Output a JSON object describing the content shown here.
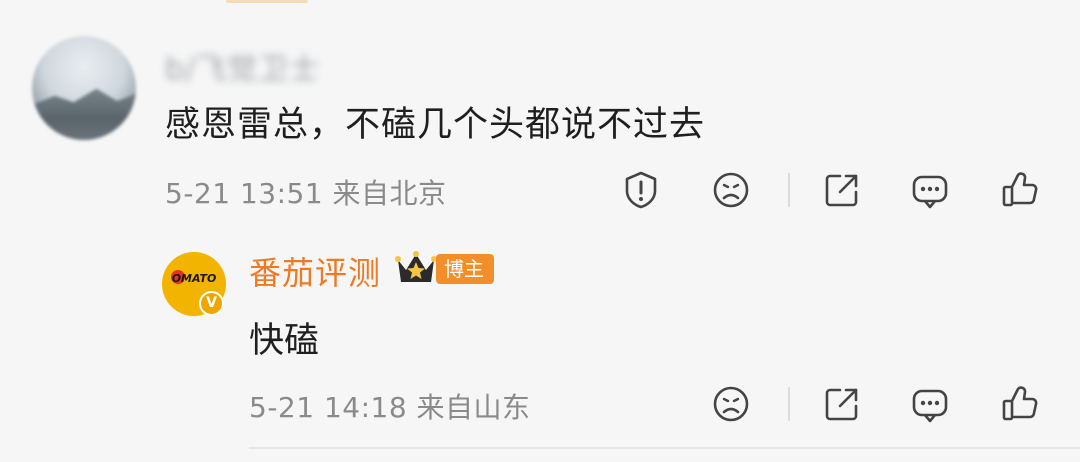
{
  "comment": {
    "username": "b/飞觉卫士",
    "text": "感恩雷总，不磕几个头都说不过去",
    "time": "5-21 13:51",
    "location": "来自北京",
    "actions": [
      "report-icon",
      "emoji-icon",
      "share-icon",
      "comment-icon",
      "like-icon"
    ]
  },
  "reply": {
    "avatar_text": "OMATO",
    "verified_mark": "V",
    "username": "番茄评测",
    "badge": "博主",
    "text": "快磕",
    "time": "5-21 14:18",
    "location": "来自山东",
    "actions": [
      "emoji-icon",
      "share-icon",
      "comment-icon",
      "like-icon"
    ]
  },
  "colors": {
    "background": "#f6f6f6",
    "accent_orange": "#ee7b24",
    "badge_orange": "#f38f2b",
    "meta_gray": "#8a8a8a",
    "text_dark": "#1f1f1f"
  }
}
